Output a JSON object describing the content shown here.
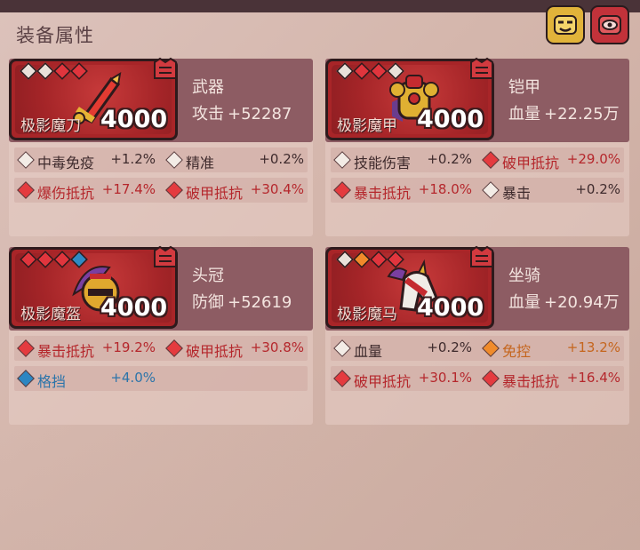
{
  "title": "装备属性",
  "top_icons": [
    "face-icon",
    "eye-icon"
  ],
  "colors": {
    "slot_red": "#a82528",
    "header_mauve": "#8d5c63",
    "stat_red": "#b5272c",
    "stat_orange": "#c5651d",
    "stat_blue": "#2b74aa",
    "stat_white": "#3e2a2c"
  },
  "cards": [
    {
      "name": "极影魔刀",
      "power": "4000",
      "kind": "武器",
      "stat_label": "攻击",
      "stat_value": "+52287",
      "gems": [
        "w",
        "w",
        "r",
        "r"
      ],
      "art": "sword-icon",
      "rows": [
        [
          {
            "name": "中毒免疫",
            "value": "+1.2%",
            "color": "white"
          },
          {
            "name": "精准",
            "value": "+0.2%",
            "color": "white"
          }
        ],
        [
          {
            "name": "爆伤抵抗",
            "value": "+17.4%",
            "color": "red"
          },
          {
            "name": "破甲抵抗",
            "value": "+30.4%",
            "color": "red"
          }
        ]
      ]
    },
    {
      "name": "极影魔甲",
      "power": "4000",
      "kind": "铠甲",
      "stat_label": "血量",
      "stat_value": "+22.25万",
      "gems": [
        "w",
        "r",
        "r",
        "w"
      ],
      "art": "armor-icon",
      "rows": [
        [
          {
            "name": "技能伤害",
            "value": "+0.2%",
            "color": "white"
          },
          {
            "name": "破甲抵抗",
            "value": "+29.0%",
            "color": "red"
          }
        ],
        [
          {
            "name": "暴击抵抗",
            "value": "+18.0%",
            "color": "red"
          },
          {
            "name": "暴击",
            "value": "+0.2%",
            "color": "white"
          }
        ]
      ]
    },
    {
      "name": "极影魔盔",
      "power": "4000",
      "kind": "头冠",
      "stat_label": "防御",
      "stat_value": "+52619",
      "gems": [
        "r",
        "r",
        "r",
        "b"
      ],
      "art": "helmet-icon",
      "rows": [
        [
          {
            "name": "暴击抵抗",
            "value": "+19.2%",
            "color": "red"
          },
          {
            "name": "破甲抵抗",
            "value": "+30.8%",
            "color": "red"
          }
        ],
        [
          {
            "name": "格挡",
            "value": "+4.0%",
            "color": "blue"
          }
        ]
      ]
    },
    {
      "name": "极影魔马",
      "power": "4000",
      "kind": "坐骑",
      "stat_label": "血量",
      "stat_value": "+20.94万",
      "gems": [
        "w",
        "o",
        "r",
        "r"
      ],
      "art": "horse-icon",
      "rows": [
        [
          {
            "name": "血量",
            "value": "+0.2%",
            "color": "white"
          },
          {
            "name": "免控",
            "value": "+13.2%",
            "color": "orange"
          }
        ],
        [
          {
            "name": "破甲抵抗",
            "value": "+30.1%",
            "color": "red"
          },
          {
            "name": "暴击抵抗",
            "value": "+16.4%",
            "color": "red"
          }
        ]
      ]
    }
  ]
}
